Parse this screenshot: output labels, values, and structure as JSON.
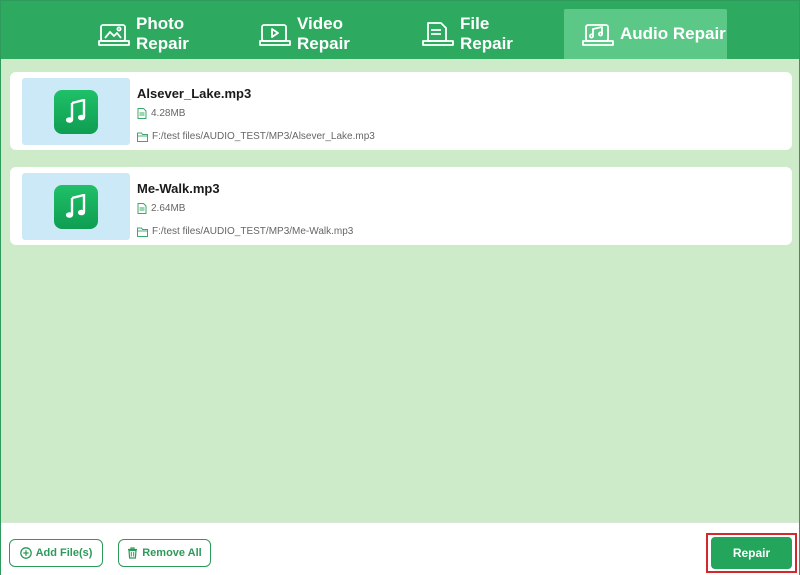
{
  "tabs": [
    {
      "label": "Photo Repair",
      "icon": "photo-repair-icon",
      "active": false
    },
    {
      "label": "Video Repair",
      "icon": "video-repair-icon",
      "active": false
    },
    {
      "label": "File Repair",
      "icon": "file-repair-icon",
      "active": false
    },
    {
      "label": "Audio Repair",
      "icon": "audio-repair-icon",
      "active": true
    }
  ],
  "files": [
    {
      "name": "Alsever_Lake.mp3",
      "size": "4.28MB",
      "path": "F:/test files/AUDIO_TEST/MP3/Alsever_Lake.mp3",
      "icon": "music-note-icon"
    },
    {
      "name": "Me-Walk.mp3",
      "size": "2.64MB",
      "path": "F:/test files/AUDIO_TEST/MP3/Me-Walk.mp3",
      "icon": "music-note-icon"
    }
  ],
  "footer": {
    "add_files_label": "Add File(s)",
    "remove_all_label": "Remove All",
    "repair_label": "Repair"
  },
  "colors": {
    "header_green": "#2daa60",
    "active_tab": "#5cc887",
    "list_background": "#cdebc8",
    "thumbnail_background": "#cbe9f6",
    "repair_button": "#24a55c",
    "highlight_border": "#d22a2a"
  }
}
